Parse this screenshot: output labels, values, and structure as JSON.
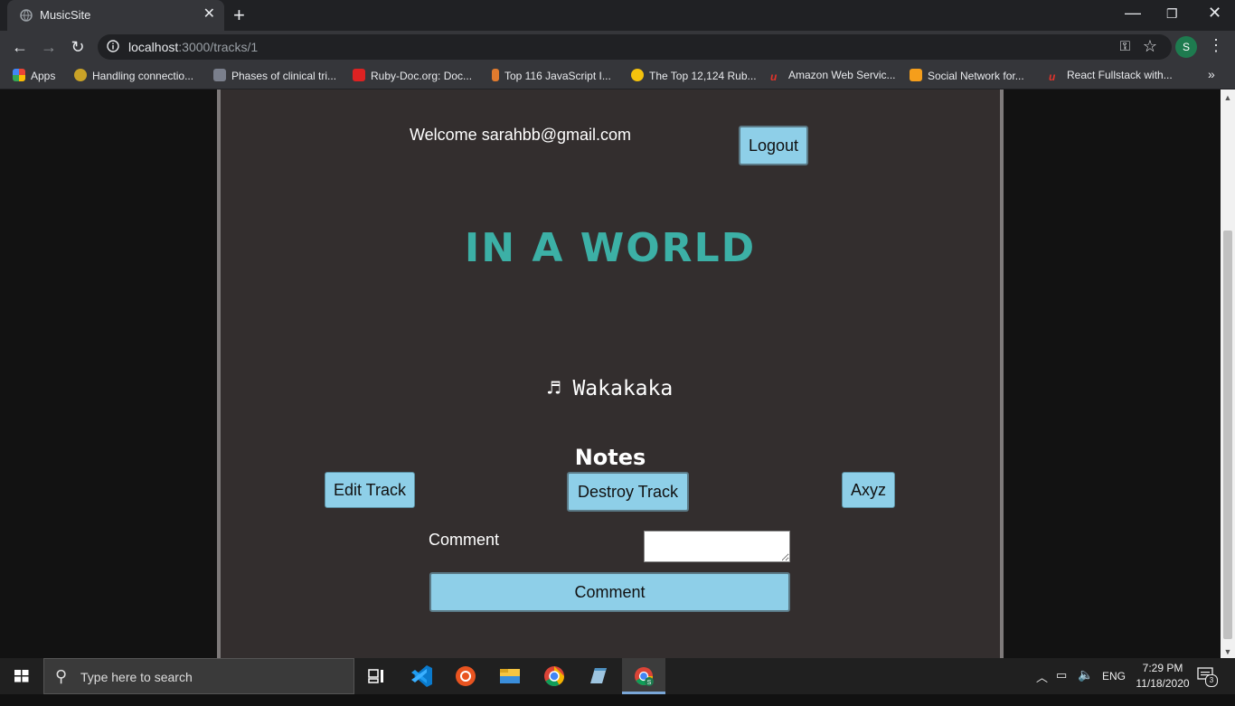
{
  "browser": {
    "tab_title": "MusicSite",
    "tab_close": "✕",
    "new_tab": "+",
    "url_host": "localhost",
    "url_path": ":3000/tracks/1",
    "profile_initial": "S",
    "bookmarks": [
      {
        "label": "Apps",
        "color": "#4285f4"
      },
      {
        "label": "Handling connectio...",
        "color": "#c9a227"
      },
      {
        "label": "Phases of clinical tri...",
        "color": "#7a7f8c"
      },
      {
        "label": "Ruby-Doc.org: Doc...",
        "color": "#d22"
      },
      {
        "label": "Top 116 JavaScript I...",
        "color": "#e07b2e"
      },
      {
        "label": "The Top 12,124 Rub...",
        "color": "#f4c20d"
      },
      {
        "label": "Amazon Web Servic...",
        "color": "#e2342b"
      },
      {
        "label": "Social Network for...",
        "color": "#f59e1b"
      },
      {
        "label": "React Fullstack with...",
        "color": "#e2342b"
      }
    ],
    "bookmarks_more": "»"
  },
  "page": {
    "welcome": "Welcome sarahbb@gmail.com",
    "logout_label": "Logout",
    "heading": "IN A WORLD",
    "track_name": "♬ Wakakaka",
    "notes_heading": "Notes",
    "edit_label": "Edit Track",
    "destroy_label": "Destroy Track",
    "axyz_label": "Axyz",
    "comment_label": "Comment",
    "comment_value": "",
    "comment_submit": "Comment"
  },
  "taskbar": {
    "search_placeholder": "Type here to search",
    "language": "ENG",
    "time": "7:29 PM",
    "date": "11/18/2020",
    "notification_count": "3"
  },
  "colors": {
    "button_bg": "#8ecfe8",
    "heading": "#3cb0a6",
    "page_bg": "#332e2e"
  }
}
